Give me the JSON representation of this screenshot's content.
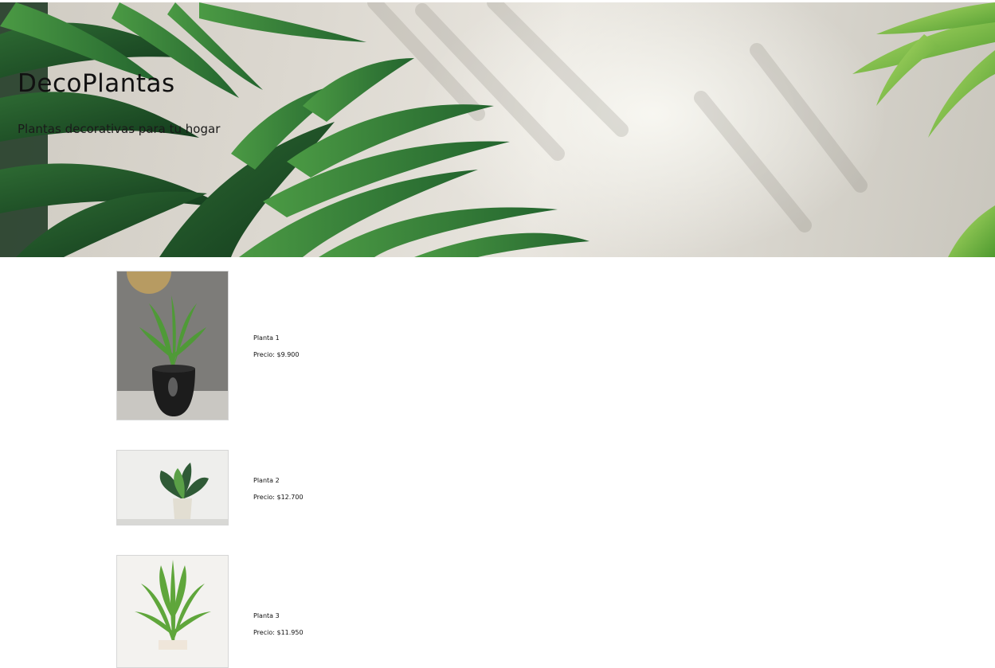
{
  "hero": {
    "title": "DecoPlantas",
    "subtitle": "Plantas decorativas para tu hogar"
  },
  "products": [
    {
      "name": "Planta 1",
      "price": "Precio: $9.900"
    },
    {
      "name": "Planta 2",
      "price": "Precio: $12.700"
    },
    {
      "name": "Planta 3",
      "price": "Precio: $11.950"
    }
  ],
  "colors": {
    "leaf_dark": "#1f5a2c",
    "leaf_mid": "#3d8a3a",
    "leaf_light": "#9fd25a",
    "wall": "#dcd8d0"
  }
}
